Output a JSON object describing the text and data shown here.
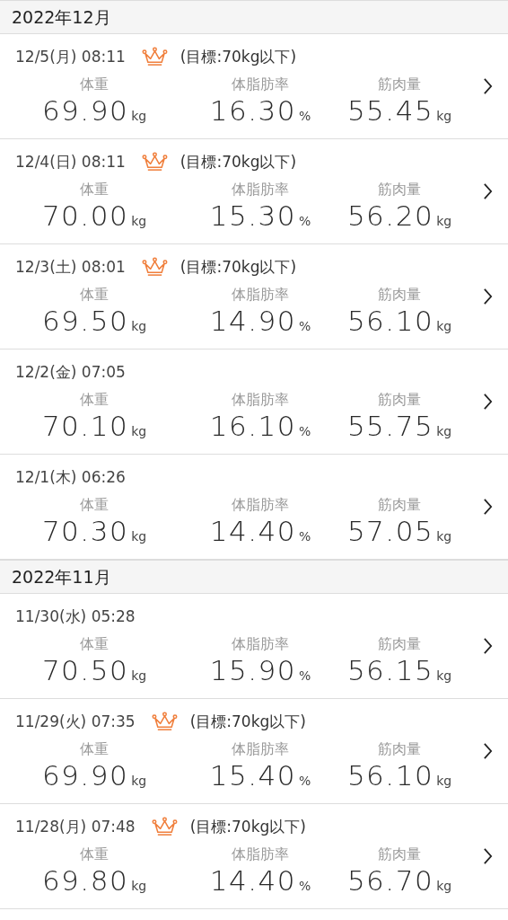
{
  "months": [
    {
      "title": "2022年12月",
      "entries": [
        {
          "date_time": "12/5(月) 08:11",
          "achieved": true,
          "goal": "(目標:70kg以下)",
          "metrics": [
            {
              "label": "体重",
              "value": "69.90",
              "unit": "kg"
            },
            {
              "label": "体脂肪率",
              "value": "16.30",
              "unit": "%"
            },
            {
              "label": "筋肉量",
              "value": "55.45",
              "unit": "kg"
            }
          ]
        },
        {
          "date_time": "12/4(日) 08:11",
          "achieved": true,
          "goal": "(目標:70kg以下)",
          "metrics": [
            {
              "label": "体重",
              "value": "70.00",
              "unit": "kg"
            },
            {
              "label": "体脂肪率",
              "value": "15.30",
              "unit": "%"
            },
            {
              "label": "筋肉量",
              "value": "56.20",
              "unit": "kg"
            }
          ]
        },
        {
          "date_time": "12/3(土) 08:01",
          "achieved": true,
          "goal": "(目標:70kg以下)",
          "metrics": [
            {
              "label": "体重",
              "value": "69.50",
              "unit": "kg"
            },
            {
              "label": "体脂肪率",
              "value": "14.90",
              "unit": "%"
            },
            {
              "label": "筋肉量",
              "value": "56.10",
              "unit": "kg"
            }
          ]
        },
        {
          "date_time": "12/2(金) 07:05",
          "achieved": false,
          "metrics": [
            {
              "label": "体重",
              "value": "70.10",
              "unit": "kg"
            },
            {
              "label": "体脂肪率",
              "value": "16.10",
              "unit": "%"
            },
            {
              "label": "筋肉量",
              "value": "55.75",
              "unit": "kg"
            }
          ]
        },
        {
          "date_time": "12/1(木) 06:26",
          "achieved": false,
          "metrics": [
            {
              "label": "体重",
              "value": "70.30",
              "unit": "kg"
            },
            {
              "label": "体脂肪率",
              "value": "14.40",
              "unit": "%"
            },
            {
              "label": "筋肉量",
              "value": "57.05",
              "unit": "kg"
            }
          ]
        }
      ]
    },
    {
      "title": "2022年11月",
      "entries": [
        {
          "date_time": "11/30(水) 05:28",
          "achieved": false,
          "metrics": [
            {
              "label": "体重",
              "value": "70.50",
              "unit": "kg"
            },
            {
              "label": "体脂肪率",
              "value": "15.90",
              "unit": "%"
            },
            {
              "label": "筋肉量",
              "value": "56.15",
              "unit": "kg"
            }
          ]
        },
        {
          "date_time": "11/29(火) 07:35",
          "achieved": true,
          "goal": "(目標:70kg以下)",
          "metrics": [
            {
              "label": "体重",
              "value": "69.90",
              "unit": "kg"
            },
            {
              "label": "体脂肪率",
              "value": "15.40",
              "unit": "%"
            },
            {
              "label": "筋肉量",
              "value": "56.10",
              "unit": "kg"
            }
          ]
        },
        {
          "date_time": "11/28(月) 07:48",
          "achieved": true,
          "goal": "(目標:70kg以下)",
          "metrics": [
            {
              "label": "体重",
              "value": "69.80",
              "unit": "kg"
            },
            {
              "label": "体脂肪率",
              "value": "14.40",
              "unit": "%"
            },
            {
              "label": "筋肉量",
              "value": "56.70",
              "unit": "kg"
            }
          ]
        }
      ]
    }
  ]
}
